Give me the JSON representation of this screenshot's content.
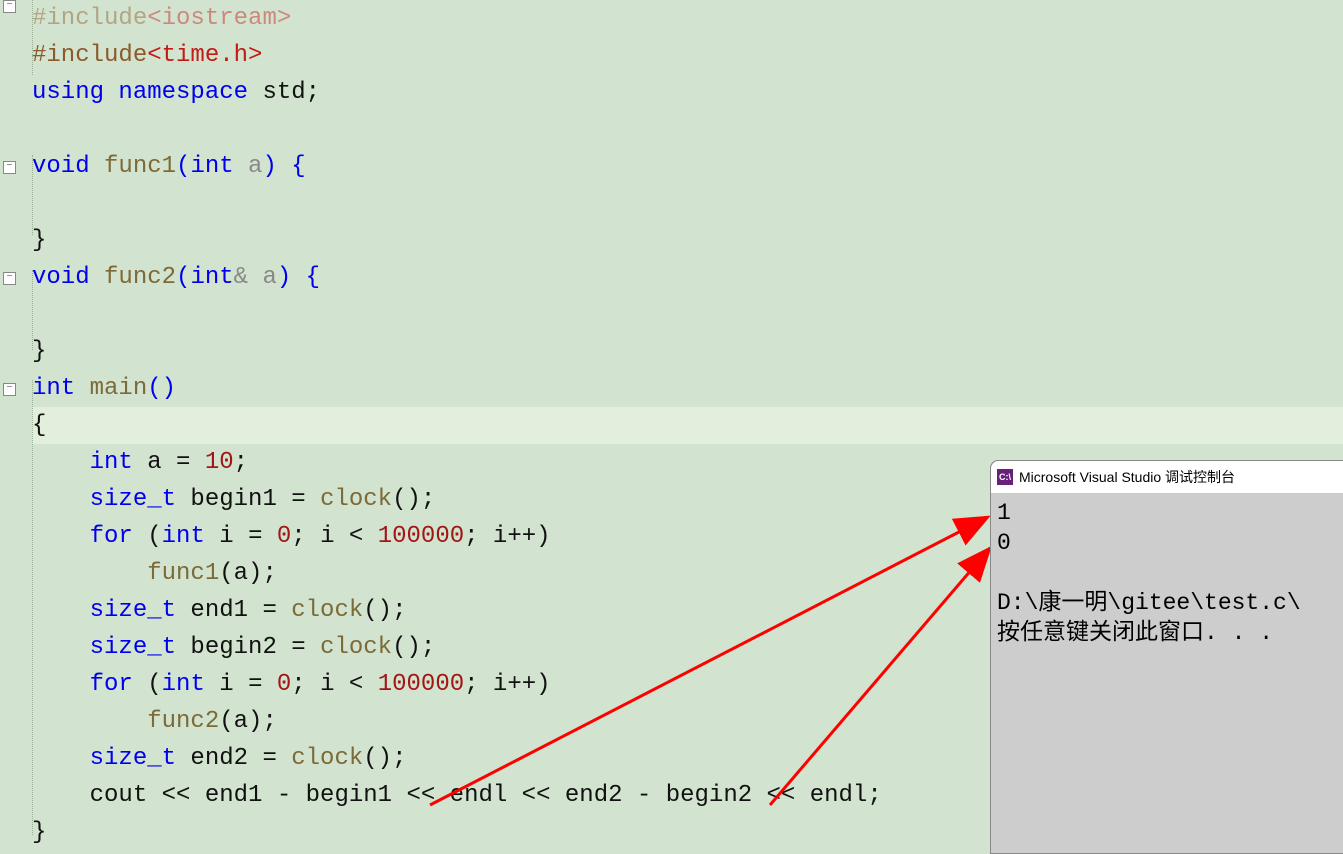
{
  "code": {
    "l0_pp": "#include",
    "l0_inc": "<iostream>",
    "l1_pp": "#include",
    "l1_inc": "<time.h>",
    "l2_a": "using",
    "l2_b": "namespace",
    "l2_c": "std;",
    "l4_a": "void",
    "l4_b": "func1",
    "l4_c": "(",
    "l4_d": "int",
    "l4_e": " a",
    "l4_f": ") {",
    "l6_a": "}",
    "l7_a": "void",
    "l7_b": "func2",
    "l7_c": "(",
    "l7_d": "int",
    "l7_e": "& a",
    "l7_f": ") {",
    "l9_a": "}",
    "l10_a": "int",
    "l10_b": "main",
    "l10_c": "()",
    "l11_a": "{",
    "l12_a": "int",
    "l12_b": " a = ",
    "l12_c": "10",
    "l12_d": ";",
    "l13_a": "size_t",
    "l13_b": " begin1 = ",
    "l13_c": "clock",
    "l13_d": "();",
    "l14_a": "for",
    "l14_b": " (",
    "l14_c": "int",
    "l14_d": " i = ",
    "l14_e": "0",
    "l14_f": "; i < ",
    "l14_g": "100000",
    "l14_h": "; i++)",
    "l15_a": "func1",
    "l15_b": "(a);",
    "l16_a": "size_t",
    "l16_b": " end1 = ",
    "l16_c": "clock",
    "l16_d": "();",
    "l17_a": "size_t",
    "l17_b": " begin2 = ",
    "l17_c": "clock",
    "l17_d": "();",
    "l18_a": "for",
    "l18_b": " (",
    "l18_c": "int",
    "l18_d": " i = ",
    "l18_e": "0",
    "l18_f": "; i < ",
    "l18_g": "100000",
    "l18_h": "; i++)",
    "l19_a": "func2",
    "l19_b": "(a);",
    "l20_a": "size_t",
    "l20_b": " end2 = ",
    "l20_c": "clock",
    "l20_d": "();",
    "l21_a": "cout << end1 - begin1 << endl << end2 - begin2 << endl;",
    "l22_a": "}"
  },
  "console": {
    "title": "Microsoft Visual Studio 调试控制台",
    "icon_text": "C:\\",
    "out1": "1",
    "out2": "0",
    "out3": "",
    "out4": "D:\\康一明\\gitee\\test.c\\",
    "out5": "按任意键关闭此窗口. . ."
  }
}
